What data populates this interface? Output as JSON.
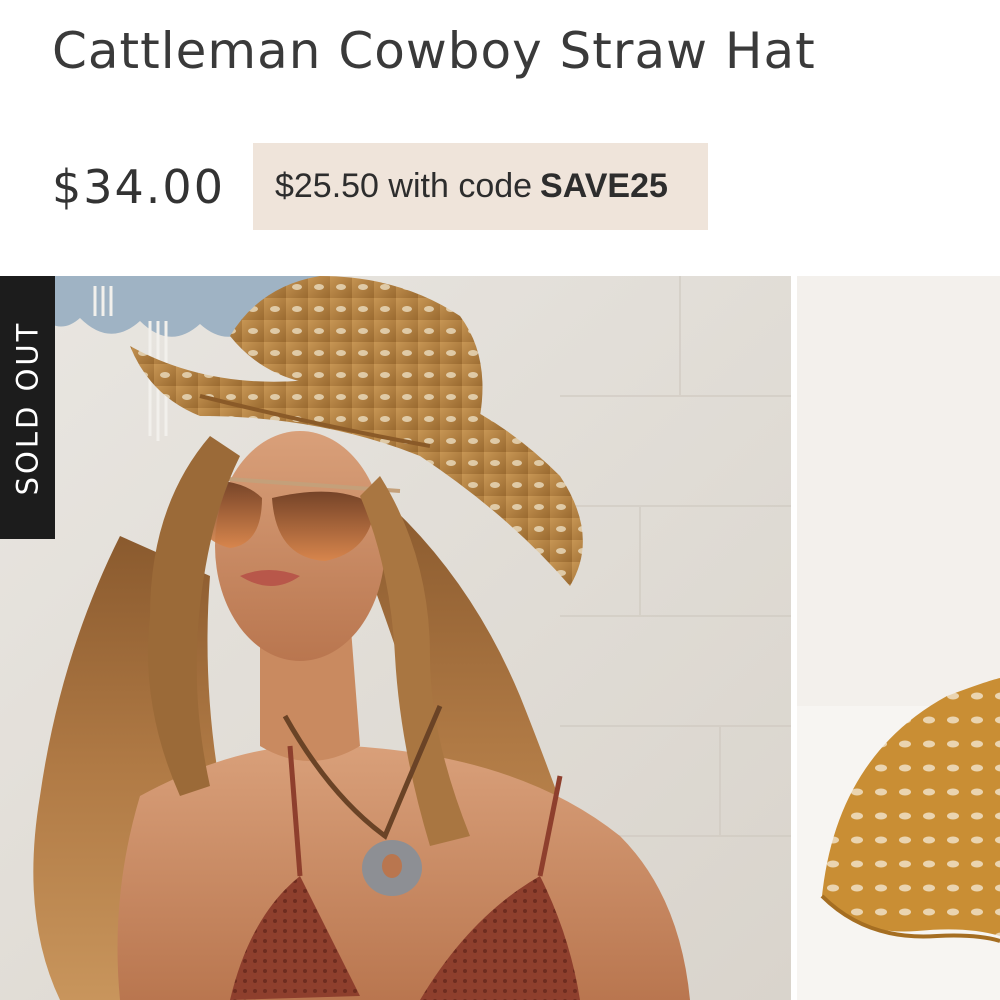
{
  "product": {
    "title": "Cattleman Cowboy Straw Hat",
    "price": "$34.00",
    "promo": {
      "text": "$25.50 with code",
      "code": "SAVE25"
    },
    "badge": "SOLD OUT"
  },
  "gallery": {
    "images": [
      {
        "name": "model-wearing-hat-photo"
      },
      {
        "name": "hat-detail-photo"
      }
    ]
  },
  "colors": {
    "promo_background": "#efe4da",
    "badge_background": "#1c1c1c",
    "text": "#333333"
  }
}
